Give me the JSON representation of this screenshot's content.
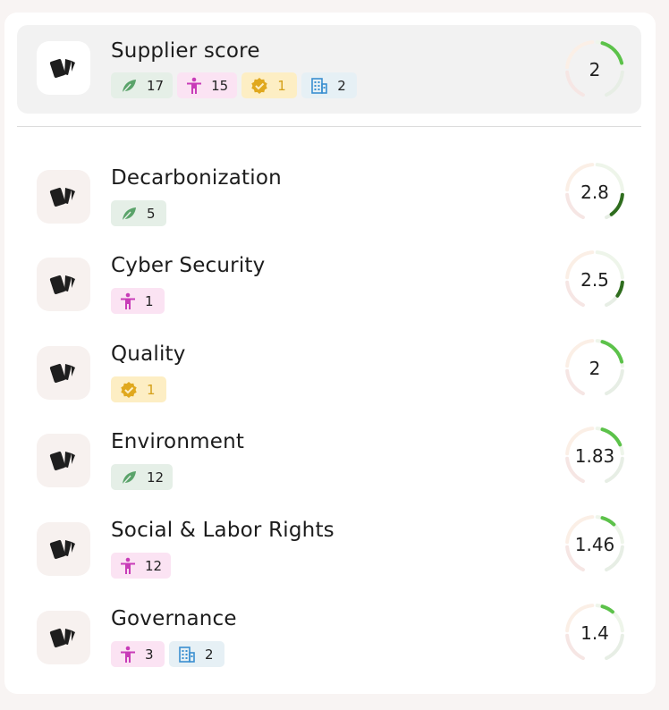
{
  "summary": {
    "title": "Supplier score",
    "score": "2",
    "score_value": 2,
    "chips": [
      {
        "type": "env",
        "icon": "leaf-icon",
        "count": "17"
      },
      {
        "type": "soc",
        "icon": "person-icon",
        "count": "15"
      },
      {
        "type": "qua",
        "icon": "badge-check-icon",
        "count": "1"
      },
      {
        "type": "gov",
        "icon": "building-icon",
        "count": "2"
      }
    ]
  },
  "categories": [
    {
      "title": "Decarbonization",
      "score": "2.8",
      "score_value": 2.8,
      "chips": [
        {
          "type": "env",
          "icon": "leaf-icon",
          "count": "5"
        }
      ]
    },
    {
      "title": "Cyber Security",
      "score": "2.5",
      "score_value": 2.5,
      "chips": [
        {
          "type": "soc",
          "icon": "person-icon",
          "count": "1"
        }
      ]
    },
    {
      "title": "Quality",
      "score": "2",
      "score_value": 2,
      "chips": [
        {
          "type": "qua",
          "icon": "badge-check-icon",
          "count": "1"
        }
      ]
    },
    {
      "title": "Environment",
      "score": "1.83",
      "score_value": 1.83,
      "chips": [
        {
          "type": "env",
          "icon": "leaf-icon",
          "count": "12"
        }
      ]
    },
    {
      "title": "Social & Labor Rights",
      "score": "1.46",
      "score_value": 1.46,
      "chips": [
        {
          "type": "soc",
          "icon": "person-icon",
          "count": "12"
        }
      ]
    },
    {
      "title": "Governance",
      "score": "1.4",
      "score_value": 1.4,
      "chips": [
        {
          "type": "soc",
          "icon": "person-icon",
          "count": "3"
        },
        {
          "type": "gov",
          "icon": "building-icon",
          "count": "2"
        }
      ]
    }
  ],
  "colors": {
    "chip_env_bg": "#e5efe7",
    "chip_soc_bg": "#fbe3f3",
    "chip_qua_bg": "#fdeec4",
    "chip_gov_bg": "#e6f0f5",
    "gauge_light_green": "#5cc24a",
    "gauge_dark_green": "#2f6d1e",
    "gauge_track": "#eee8e5"
  }
}
